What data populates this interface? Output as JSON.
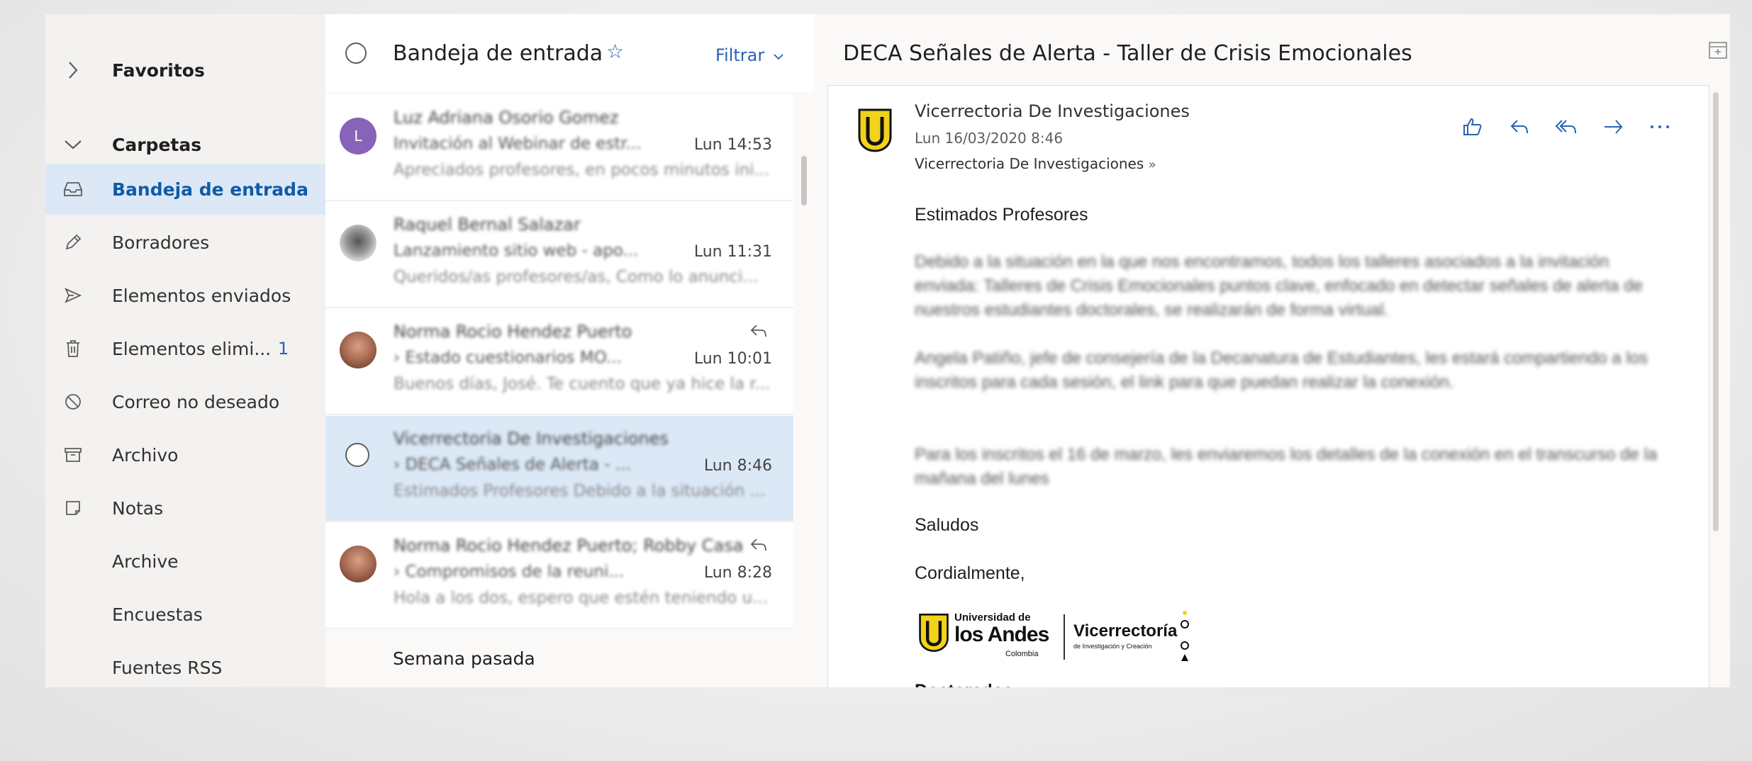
{
  "folders": {
    "favorites_label": "Favoritos",
    "folders_label": "Carpetas",
    "items": [
      {
        "label": "Bandeja de entrada",
        "icon": "inbox-icon",
        "active": true
      },
      {
        "label": "Borradores",
        "icon": "pencil-icon"
      },
      {
        "label": "Elementos enviados",
        "icon": "send-icon"
      },
      {
        "label": "Elementos elimi...",
        "icon": "trash-icon",
        "count": "1"
      },
      {
        "label": "Correo no deseado",
        "icon": "block-icon"
      },
      {
        "label": "Archivo",
        "icon": "archive-icon"
      },
      {
        "label": "Notas",
        "icon": "note-icon"
      },
      {
        "label": "Archive",
        "icon": ""
      },
      {
        "label": "Encuestas",
        "icon": ""
      },
      {
        "label": "Fuentes RSS",
        "icon": ""
      }
    ]
  },
  "list": {
    "title": "Bandeja de entrada",
    "filter_label": "Filtrar",
    "messages": [
      {
        "avatar_letter": "L",
        "avatar_color": "#8764b8",
        "sender": "Luz Adriana Osorio Gomez",
        "subject": "Invitación al Webinar de estr...",
        "time": "Lun 14:53",
        "preview": "Apreciados profesores, en pocos minutos ini..."
      },
      {
        "avatar_letter": "",
        "avatar_color": "#b8b8b8",
        "sender": "Raquel Bernal Salazar",
        "subject": "Lanzamiento sitio web - apo...",
        "time": "Lun 11:31",
        "preview": "Queridos/as profesores/as, Como lo anunci..."
      },
      {
        "avatar_letter": "",
        "avatar_color": "#a0644c",
        "sender": "Norma Rocio Hendez Puerto",
        "subject": "Estado cuestionarios MO...",
        "time": "Lun 10:01",
        "preview": "Buenos días, José. Te cuento que ya hice la r..."
      },
      {
        "avatar_letter": "",
        "avatar_color": "",
        "sender": "Vicerrectoria De Investigaciones",
        "subject": "DECA Señales de Alerta - ...",
        "time": "Lun 8:46",
        "preview": "Estimados Profesores Debido a la situación ..."
      },
      {
        "avatar_letter": "",
        "avatar_color": "#a0644c",
        "sender": "Norma Rocio Hendez Puerto; Robby Casa",
        "subject": "Compromisos de la reuni...",
        "time": "Lun 8:28",
        "preview": "Hola a los dos, espero que estén teniendo u..."
      }
    ],
    "group_label": "Semana pasada"
  },
  "reading": {
    "title": "DECA Señales de Alerta - Taller de Crisis Emocionales",
    "from": "Vicerrectoria De Investigaciones",
    "date": "Lun 16/03/2020 8:46",
    "to": "Vicerrectoria De Investigaciones",
    "greeting": "Estimados Profesores",
    "paragraphs": [
      "Debido a la situación en la que nos encontramos, todos los talleres asociados a la invitación enviada: Talleres de Crisis Emocionales puntos clave, enfocado en detectar señales de alerta de nuestros estudiantes doctorales, se realizarán de forma virtual.",
      "Angela Patiño, jefe de consejería de la Decanatura de Estudiantes, les estará compartiendo a los inscritos para cada sesión, el link para que puedan realizar la conexión.",
      "Para los inscritos el 16 de marzo, les enviaremos los detalles de la conexión en el transcurso de la mañana del lunes"
    ],
    "salutation": "Saludos",
    "closing": "Cordialmente,",
    "signature": {
      "uni_line1": "Universidad de",
      "uni_line2": "los Andes",
      "uni_country": "Colombia",
      "vice_name": "Vicerrectoría",
      "vice_sub": "de Investigación y Creación"
    },
    "doctorados": "Doctorados"
  },
  "colors": {
    "accent": "#2b62b5",
    "selected": "#dbe8f6",
    "folder_active": "#dce8f6",
    "uniandes_yellow": "#f2d21b"
  }
}
